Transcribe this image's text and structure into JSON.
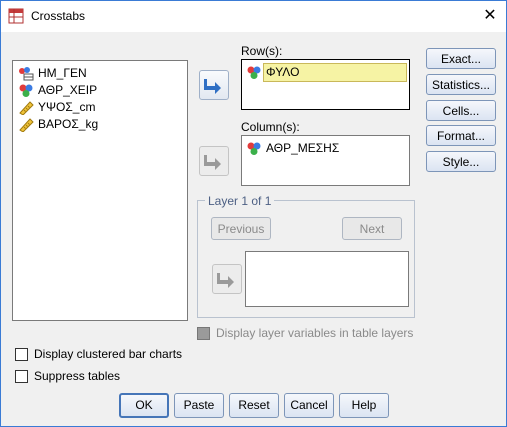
{
  "window": {
    "title": "Crosstabs",
    "close_glyph": "✕"
  },
  "source_list": {
    "items": [
      {
        "label": "ΗΜ_ΓΕΝ",
        "icon": "date-variable-icon"
      },
      {
        "label": "ΑΘΡ_ΧΕΙΡ",
        "icon": "nominal-variable-icon"
      },
      {
        "label": "ΥΨΟΣ_cm",
        "icon": "scale-variable-icon"
      },
      {
        "label": "ΒΑΡΟΣ_kg",
        "icon": "scale-variable-icon"
      }
    ]
  },
  "rows": {
    "label": "Row(s):",
    "items": [
      {
        "label": "ΦΥΛΟ",
        "icon": "nominal-variable-icon"
      }
    ]
  },
  "columns": {
    "label": "Column(s):",
    "items": [
      {
        "label": "ΑΘΡ_ΜΕΣΗΣ",
        "icon": "nominal-variable-icon"
      }
    ]
  },
  "layer": {
    "legend": "Layer 1 of 1",
    "previous": "Previous",
    "next": "Next"
  },
  "side_buttons": [
    "Exact...",
    "Statistics...",
    "Cells...",
    "Format...",
    "Style..."
  ],
  "options": {
    "display_layer": "Display layer variables in table layers",
    "clustered_bar": "Display clustered bar charts",
    "suppress_tables": "Suppress tables"
  },
  "bottom_buttons": {
    "ok": "OK",
    "paste": "Paste",
    "reset": "Reset",
    "cancel": "Cancel",
    "help": "Help"
  },
  "colors": {
    "accent_border": "#3a7bd5",
    "button_border": "#7d95b8",
    "selection_fill": "#f6f3a4",
    "arrow_blue": "#2f6fc4",
    "arrow_gray": "#9a9a9a"
  }
}
